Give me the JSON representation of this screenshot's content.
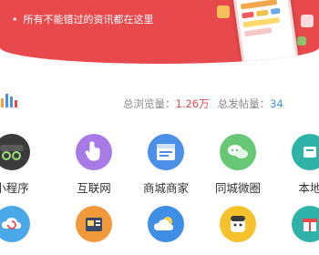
{
  "banner": {
    "text": "所有不能错过的资讯都在这里",
    "dot": "•",
    "color": "#e7494c"
  },
  "stats": {
    "views_label": "总浏览量：",
    "views_value": "1.26万",
    "posts_label": "总发帖量：",
    "posts_value": "34"
  },
  "grid": {
    "row1": [
      {
        "label": "小程序",
        "icon": "mini-program-icon",
        "color": "#444444"
      },
      {
        "label": "互联网",
        "icon": "touch-hand-icon",
        "color": "#9b6ee0"
      },
      {
        "label": "商城商家",
        "icon": "shop-window-icon",
        "color": "#4c8fe7"
      },
      {
        "label": "同城微圈",
        "icon": "chat-bubbles-icon",
        "color": "#5cc46c"
      },
      {
        "label": "本地",
        "icon": "local-icon",
        "color": "#2fb3a8"
      }
    ],
    "row2": [
      {
        "label": "",
        "icon": "cloud-refresh-icon",
        "color": "#4aa8e8"
      },
      {
        "label": "",
        "icon": "camera-store-icon",
        "color": "#f09a3c"
      },
      {
        "label": "",
        "icon": "weather-icon",
        "color": "#3f8ee6"
      },
      {
        "label": "",
        "icon": "face-icon",
        "color": "#f6c22c"
      },
      {
        "label": "",
        "icon": "gift-icon",
        "color": "#2fb3a8"
      }
    ]
  }
}
